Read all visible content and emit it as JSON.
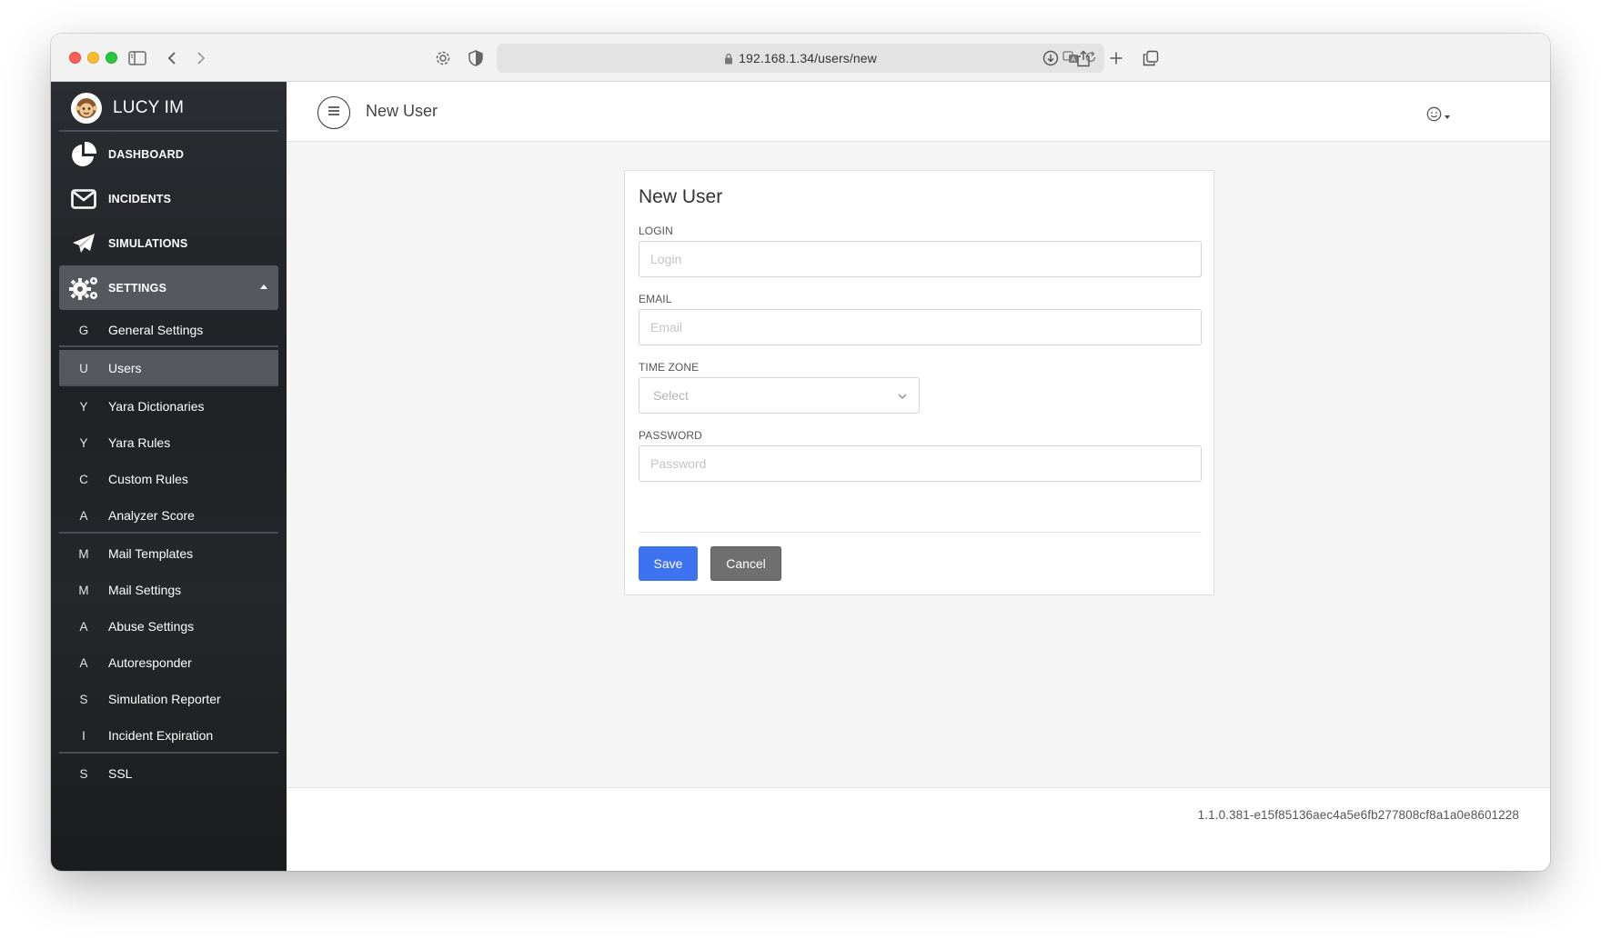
{
  "browser": {
    "url": "192.168.1.34/users/new"
  },
  "sidebar": {
    "brand": "LUCY IM",
    "main_items": [
      {
        "label": "DASHBOARD",
        "icon": "pie-chart-icon"
      },
      {
        "label": "INCIDENTS",
        "icon": "envelope-icon"
      },
      {
        "label": "SIMULATIONS",
        "icon": "paper-plane-icon"
      },
      {
        "label": "SETTINGS",
        "icon": "gears-icon"
      }
    ],
    "sub_items": [
      {
        "abbr": "G",
        "label": "General Settings"
      },
      {
        "abbr": "U",
        "label": "Users"
      },
      {
        "abbr": "Y",
        "label": "Yara Dictionaries"
      },
      {
        "abbr": "Y",
        "label": "Yara Rules"
      },
      {
        "abbr": "C",
        "label": "Custom Rules"
      },
      {
        "abbr": "A",
        "label": "Analyzer Score"
      },
      {
        "abbr": "M",
        "label": "Mail Templates"
      },
      {
        "abbr": "M",
        "label": "Mail Settings"
      },
      {
        "abbr": "A",
        "label": "Abuse Settings"
      },
      {
        "abbr": "A",
        "label": "Autoresponder"
      },
      {
        "abbr": "S",
        "label": "Simulation Reporter"
      },
      {
        "abbr": "I",
        "label": "Incident Expiration"
      },
      {
        "abbr": "S",
        "label": "SSL"
      }
    ]
  },
  "header": {
    "title": "New User"
  },
  "form": {
    "title": "New User",
    "login_label": "LOGIN",
    "login_placeholder": "Login",
    "login_value": "",
    "email_label": "EMAIL",
    "email_placeholder": "Email",
    "email_value": "",
    "timezone_label": "TIME ZONE",
    "timezone_selected": "Select",
    "password_label": "PASSWORD",
    "password_placeholder": "Password",
    "password_value": "",
    "save_label": "Save",
    "cancel_label": "Cancel"
  },
  "footer": {
    "version": "1.1.0.381-e15f85136aec4a5e6fb277808cf8a1a0e8601228"
  },
  "colors": {
    "primary": "#3d73f0",
    "secondary": "#6f6f6f",
    "sidebar_bg": "#1f2124",
    "sidebar_active": "#55595e"
  }
}
